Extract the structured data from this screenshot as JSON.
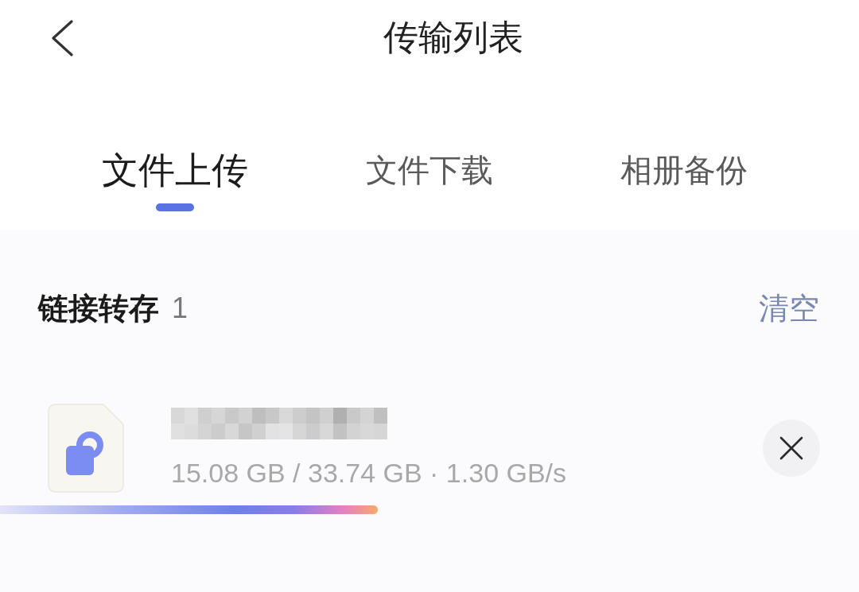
{
  "header": {
    "title": "传输列表"
  },
  "tabs": [
    {
      "label": "文件上传",
      "selected": true
    },
    {
      "label": "文件下载",
      "selected": false
    },
    {
      "label": "相册备份",
      "selected": false
    }
  ],
  "section": {
    "title": "链接转存",
    "count": "1",
    "action": "清空"
  },
  "transfers": [
    {
      "size_info": "15.08 GB / 33.74 GB · 1.30 GB/s",
      "level": 0.44
    }
  ]
}
